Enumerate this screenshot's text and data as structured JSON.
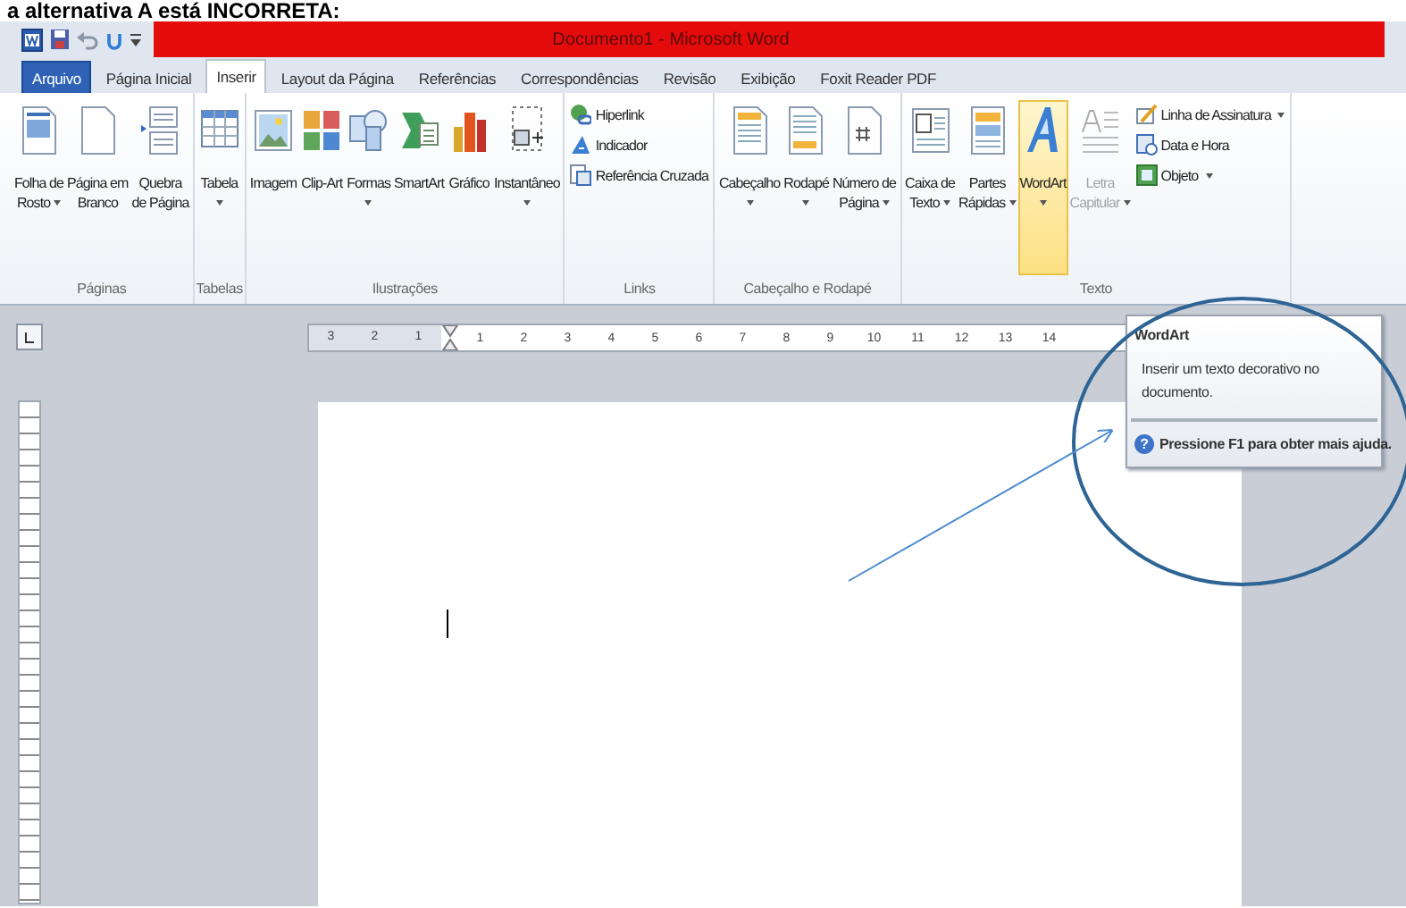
{
  "caption": "a alternativa A está INCORRETA:",
  "window": {
    "title": "Documento1 - Microsoft Word"
  },
  "tabs": [
    {
      "label": "Arquivo",
      "kind": "file",
      "selected": false
    },
    {
      "label": "Página Inicial",
      "kind": "tab",
      "selected": false
    },
    {
      "label": "Inserir",
      "kind": "tab",
      "selected": true
    },
    {
      "label": "Layout da Página",
      "kind": "tab",
      "selected": false
    },
    {
      "label": "Referências",
      "kind": "tab",
      "selected": false
    },
    {
      "label": "Correspondências",
      "kind": "tab",
      "selected": false
    },
    {
      "label": "Revisão",
      "kind": "tab",
      "selected": false
    },
    {
      "label": "Exibição",
      "kind": "tab",
      "selected": false
    },
    {
      "label": "Foxit Reader PDF",
      "kind": "tab",
      "selected": false
    }
  ],
  "ribbon": {
    "groups": [
      {
        "label": "Páginas",
        "buttons": [
          {
            "lines": [
              "Folha de",
              "Rosto"
            ],
            "dropdown": true,
            "highlighted": false,
            "disabled": false
          },
          {
            "lines": [
              "Página em",
              "Branco"
            ],
            "dropdown": false,
            "highlighted": false,
            "disabled": false
          },
          {
            "lines": [
              "Quebra",
              "de Página"
            ],
            "dropdown": false,
            "highlighted": false,
            "disabled": false
          }
        ]
      },
      {
        "label": "Tabelas",
        "buttons": [
          {
            "lines": [
              "Tabela"
            ],
            "dropdown": true,
            "highlighted": false,
            "disabled": false
          }
        ]
      },
      {
        "label": "Ilustrações",
        "buttons": [
          {
            "lines": [
              "Imagem"
            ],
            "dropdown": false,
            "highlighted": false,
            "disabled": false
          },
          {
            "lines": [
              "Clip-Art"
            ],
            "dropdown": false,
            "highlighted": false,
            "disabled": false
          },
          {
            "lines": [
              "Formas"
            ],
            "dropdown": true,
            "highlighted": false,
            "disabled": false
          },
          {
            "lines": [
              "SmartArt"
            ],
            "dropdown": false,
            "highlighted": false,
            "disabled": false
          },
          {
            "lines": [
              "Gráfico"
            ],
            "dropdown": false,
            "highlighted": false,
            "disabled": false
          },
          {
            "lines": [
              "Instantâneo"
            ],
            "dropdown": true,
            "highlighted": false,
            "disabled": false
          }
        ]
      },
      {
        "label": "Links",
        "small_buttons": [
          {
            "label": "Hiperlink",
            "dropdown": false
          },
          {
            "label": "Indicador",
            "dropdown": false
          },
          {
            "label": "Referência Cruzada",
            "dropdown": false
          }
        ]
      },
      {
        "label": "Cabeçalho e Rodapé",
        "buttons": [
          {
            "lines": [
              "Cabeçalho"
            ],
            "dropdown": true,
            "highlighted": false,
            "disabled": false
          },
          {
            "lines": [
              "Rodapé"
            ],
            "dropdown": true,
            "highlighted": false,
            "disabled": false
          },
          {
            "lines": [
              "Número de",
              "Página"
            ],
            "dropdown": true,
            "highlighted": false,
            "disabled": false
          }
        ]
      },
      {
        "label": "Texto",
        "buttons": [
          {
            "lines": [
              "Caixa de",
              "Texto"
            ],
            "dropdown": true,
            "highlighted": false,
            "disabled": false
          },
          {
            "lines": [
              "Partes",
              "Rápidas"
            ],
            "dropdown": true,
            "highlighted": false,
            "disabled": false
          },
          {
            "lines": [
              "WordArt"
            ],
            "dropdown": true,
            "highlighted": true,
            "disabled": false
          },
          {
            "lines": [
              "Letra",
              "Capitular"
            ],
            "dropdown": true,
            "highlighted": false,
            "disabled": true
          }
        ],
        "small_buttons": [
          {
            "label": "Linha de Assinatura",
            "dropdown": true
          },
          {
            "label": "Data e Hora",
            "dropdown": false
          },
          {
            "label": "Objeto",
            "dropdown": true
          }
        ]
      }
    ]
  },
  "ruler": {
    "left_numbers": [
      "3",
      "2",
      "1"
    ],
    "right_numbers": [
      "1",
      "2",
      "3",
      "4",
      "5",
      "6",
      "7",
      "8",
      "9",
      "10",
      "11",
      "12",
      "13",
      "14"
    ]
  },
  "tooltip": {
    "title": "WordArt",
    "body": "Inserir um texto decorativo no documento.",
    "help_glyph": "?",
    "help": "Pressione F1 para obter mais ajuda."
  }
}
